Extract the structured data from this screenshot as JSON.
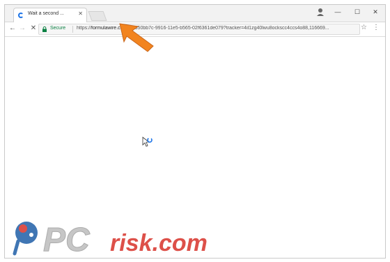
{
  "browser": {
    "tab": {
      "title": "Wait a second ..."
    },
    "address_bar": {
      "secure_label": "Secure",
      "url_scheme": "https://",
      "url_host": "formulawire.com",
      "url_rest": "/c/a350bb7c-9916-11e5-b565-02f6361de079?tracker=4il1zg40lwu8ockscc4ccs4o88,116669..."
    },
    "window_controls": {
      "minimize": "—",
      "maximize": "☐",
      "close": "✕"
    }
  },
  "icons": [
    "chrome-favicon-spinner",
    "close-icon",
    "back-arrow-icon",
    "forward-arrow-icon",
    "stop-loading-icon",
    "lock-icon",
    "star-icon",
    "menu-icon",
    "profile-icon",
    "loading-cursor-icon",
    "orange-pointer-arrow"
  ],
  "watermark": {
    "text_pc": "PC",
    "text_risk": "risk.com"
  },
  "colors": {
    "secure_green": "#0b8043",
    "arrow_orange": "#f2841f",
    "watermark_red": "#d8322a"
  }
}
